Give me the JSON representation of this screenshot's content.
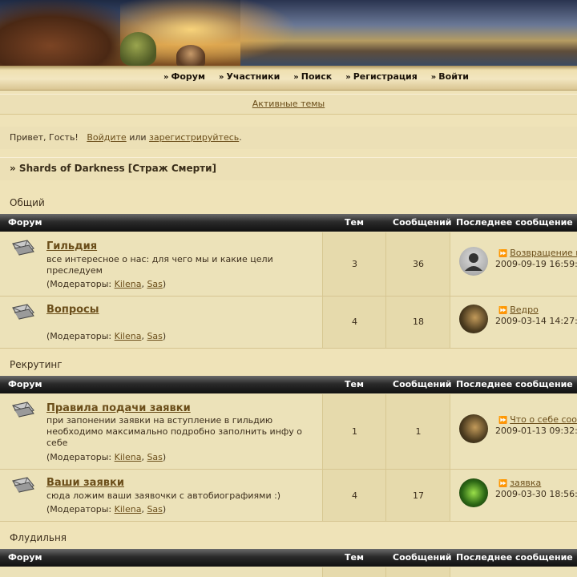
{
  "nav": {
    "items": [
      {
        "label": "Форум"
      },
      {
        "label": "Участники"
      },
      {
        "label": "Поиск"
      },
      {
        "label": "Регистрация"
      },
      {
        "label": "Войти"
      }
    ]
  },
  "active_topics": "Активные темы",
  "greeting": {
    "prefix": "Привет, Гость!",
    "login": "Войдите",
    "or": "или",
    "register": "зарегистрируйтесь",
    "suffix": "."
  },
  "breadcrumb": "» Shards of Darkness [Страж Смерти]",
  "table_headers": {
    "forum": "Форум",
    "topics": "Тем",
    "posts": "Сообщений",
    "last": "Последнее сообщение"
  },
  "categories": [
    {
      "title": "Общий",
      "forums": [
        {
          "title": "Гильдия",
          "desc": "все интересное о нас: для чего мы и какие цели преследуем",
          "mods_label": "(Модераторы:",
          "mod1": "Kilena",
          "mod2": "Sas",
          "close": ")",
          "topics": "3",
          "posts": "36",
          "last_title": "Возвращение г",
          "last_date": "2009-09-19 16:59:"
        },
        {
          "title": "Вопросы",
          "desc": "",
          "mods_label": "(Модераторы:",
          "mod1": "Kilena",
          "mod2": "Sas",
          "close": ")",
          "topics": "4",
          "posts": "18",
          "last_title": "Ведро",
          "last_date": "2009-03-14 14:27:"
        }
      ]
    },
    {
      "title": "Рекрутинг",
      "forums": [
        {
          "title": "Правила подачи заявки",
          "desc": "при запонении заявки на вступление в гильдию необходимо максимально подробно заполнить инфу о себе",
          "mods_label": "(Модераторы:",
          "mod1": "Kilena",
          "mod2": "Sas",
          "close": ")",
          "topics": "1",
          "posts": "1",
          "last_title": "Что о себе сооб",
          "last_date": "2009-01-13 09:32:"
        },
        {
          "title": "Ваши заявки",
          "desc": "сюда ложим ваши заявочки с автобиографиями :)",
          "mods_label": "(Модераторы:",
          "mod1": "Kilena",
          "mod2": "Sas",
          "close": ")",
          "topics": "4",
          "posts": "17",
          "last_title": "заявка",
          "last_date": "2009-03-30 18:56:"
        }
      ]
    },
    {
      "title": "Флудильня",
      "forums": []
    }
  ],
  "colors": {
    "background": "#efe3b8",
    "link": "#6b4e1a",
    "header_bar": "#1a1a1a"
  }
}
